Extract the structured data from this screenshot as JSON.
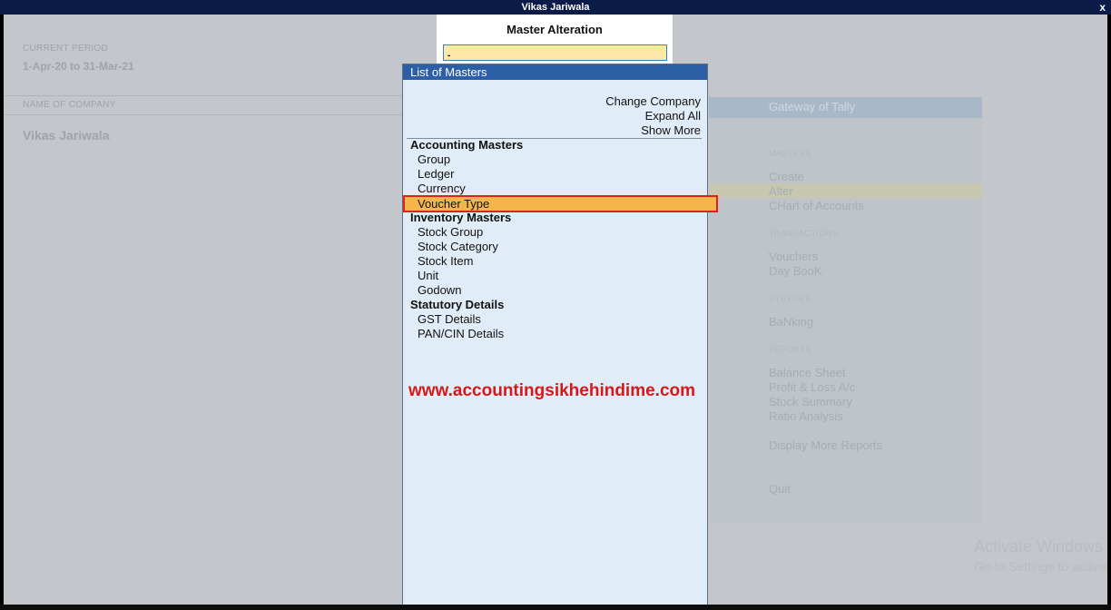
{
  "window": {
    "title": "Vikas Jariwala",
    "close_label": "x"
  },
  "background": {
    "current_period_label": "CURRENT PERIOD",
    "current_period_value": "1-Apr-20 to 31-Mar-21",
    "name_of_company_label": "NAME OF COMPANY",
    "company_name": "Vikas Jariwala"
  },
  "gateway": {
    "title": "Gateway of Tally",
    "masters_head": "MASTERS",
    "create": "Create",
    "alter": "Alter",
    "chart_of_accounts": "CHart of Accounts",
    "transactions_head": "TRANSACTIONS",
    "vouchers": "Vouchers",
    "day_book": "Day BooK",
    "utilities_head": "UTILITIES",
    "banking": "BaNking",
    "reports_head": "REPORTS",
    "balance_sheet": "Balance Sheet",
    "profit_loss": "Profit & Loss A/c",
    "stock_summary": "Stock Summary",
    "ratio_analysis": "Ratio Analysis",
    "display_more_reports": "Display More Reports",
    "quit": "Quit"
  },
  "master_alteration": {
    "title": "Master Alteration",
    "input_value": "-"
  },
  "list": {
    "header": "List of Masters",
    "actions": [
      "Change Company",
      "Expand All",
      "Show More"
    ],
    "sections": [
      {
        "title": "Accounting Masters",
        "items": [
          "Group",
          "Ledger",
          "Currency",
          "Voucher Type"
        ]
      },
      {
        "title": "Inventory Masters",
        "items": [
          "Stock Group",
          "Stock Category",
          "Stock Item",
          "Unit",
          "Godown"
        ]
      },
      {
        "title": "Statutory Details",
        "items": [
          "GST Details",
          "PAN/CIN Details"
        ]
      }
    ],
    "website": "www.accountingsikhehindime.com"
  },
  "watermark": {
    "line1": "Activate Windows",
    "line2": "Go to Settings to activate Windows."
  }
}
